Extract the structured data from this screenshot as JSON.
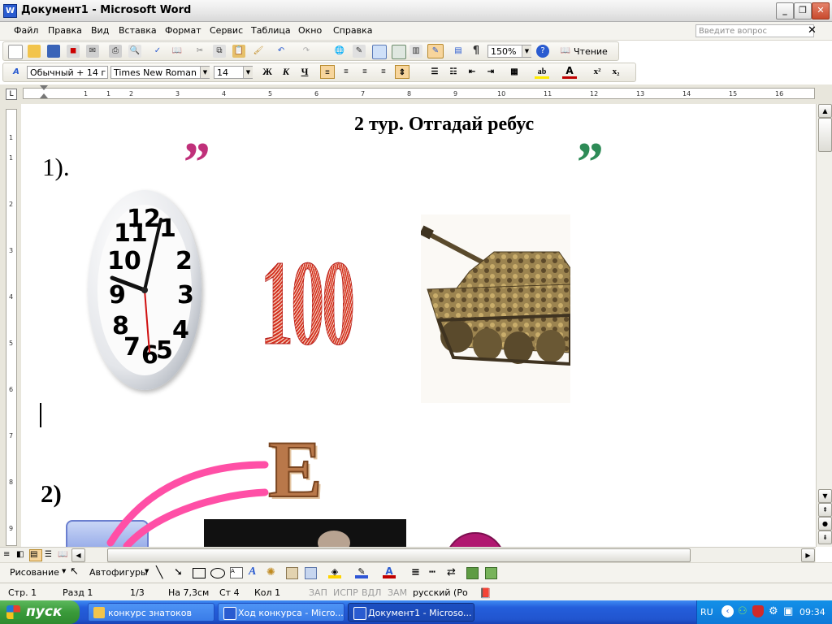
{
  "window": {
    "title": "Документ1 - Microsoft Word",
    "app_icon": "W"
  },
  "menu": {
    "items": [
      "Файл",
      "Правка",
      "Вид",
      "Вставка",
      "Формат",
      "Сервис",
      "Таблица",
      "Окно",
      "Справка"
    ],
    "help_placeholder": "Введите вопрос"
  },
  "standard_toolbar": {
    "zoom": "150%",
    "read_button": "Чтение",
    "paragraph_mark": "¶"
  },
  "formatting_toolbar": {
    "style": "Обычный + 14 г",
    "font": "Times New Roman",
    "size": "14",
    "bold": "Ж",
    "italic": "К",
    "underline": "Ч"
  },
  "ruler": {
    "numbers": [
      "1",
      "1",
      "2",
      "3",
      "4",
      "5",
      "6",
      "7",
      "8",
      "9",
      "10",
      "11",
      "12",
      "13",
      "14",
      "15",
      "16"
    ],
    "vertical_numbers": [
      "1",
      "1",
      "2",
      "3",
      "4",
      "5",
      "6",
      "7",
      "8",
      "9"
    ]
  },
  "document": {
    "heading": "2 тур. Отгадай ребус",
    "puzzle1_label": "1).",
    "quote_left": "”",
    "quote_right": "”",
    "clock_numbers": [
      "12",
      "1",
      "2",
      "3",
      "4",
      "5",
      "6",
      "7",
      "8",
      "9",
      "10",
      "11"
    ],
    "number_100": "100",
    "puzzle2_label": "2)",
    "letter_e": "Е"
  },
  "drawing_toolbar": {
    "draw_menu": "Рисование",
    "autoshapes": "Автофигуры"
  },
  "statusbar": {
    "page": "Стр. 1",
    "section": "Разд 1",
    "pages": "1/3",
    "at": "На 7,3см",
    "line": "Ст 4",
    "col": "Кол 1",
    "rec": "ЗАП",
    "trk": "ИСПР",
    "ext": "ВДЛ",
    "ovr": "ЗАМ",
    "lang": "русский (Ро"
  },
  "taskbar": {
    "start": "пуск",
    "tasks": [
      "конкурс знатоков",
      "Ход конкурса - Micro...",
      "Документ1 - Microso..."
    ],
    "lang": "RU",
    "time": "09:34"
  },
  "colors": {
    "accent": "#245edb",
    "quote_left": "#c0307a",
    "quote_right": "#2e8b57",
    "arrow_pink": "#ff4fa6"
  }
}
